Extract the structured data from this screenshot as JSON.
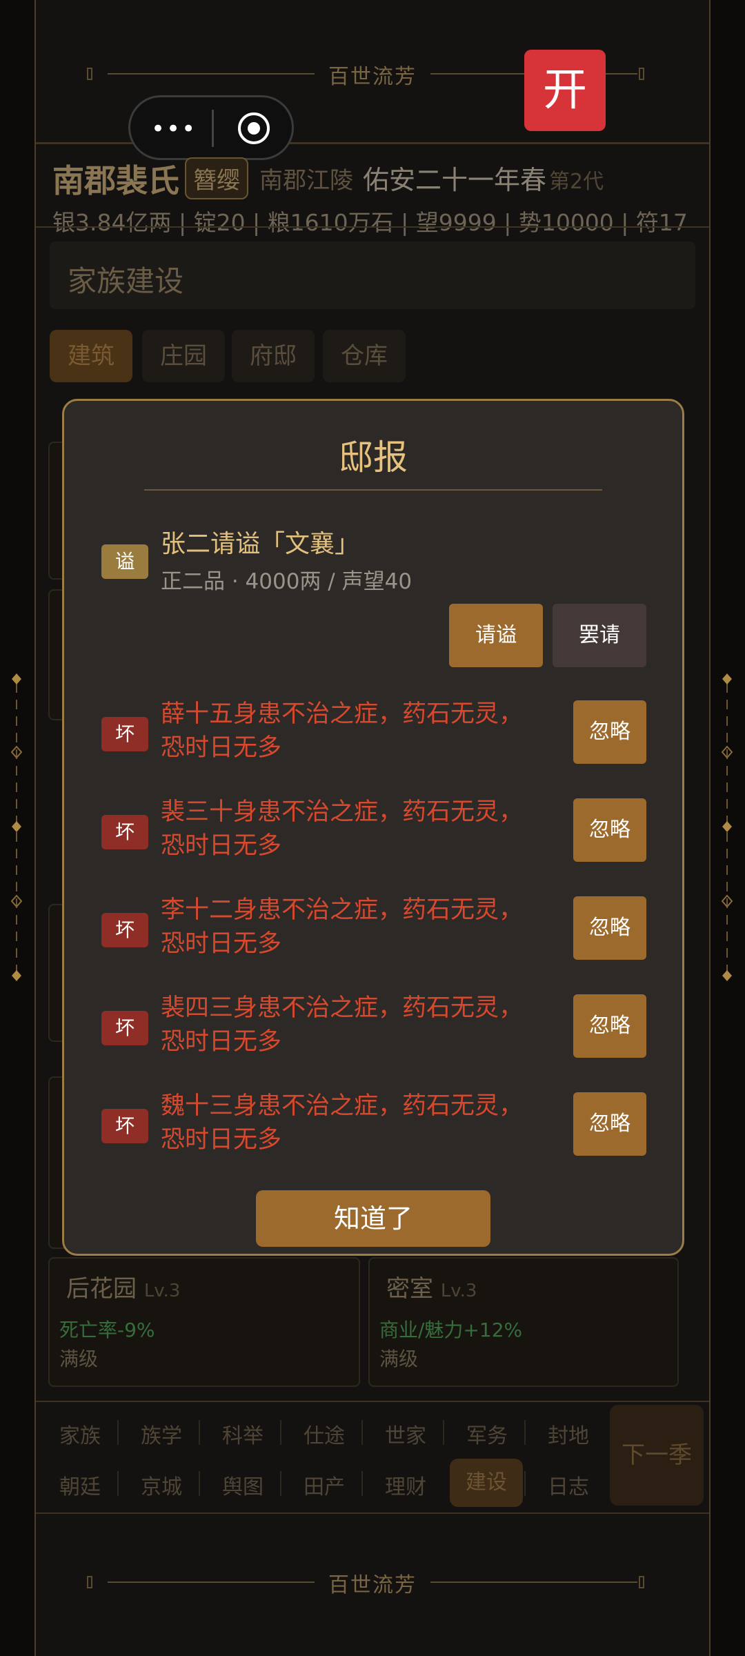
{
  "banner": {
    "text": "百世流芳"
  },
  "capsule": {
    "dots": "•••"
  },
  "open_button": {
    "label": "开"
  },
  "header": {
    "clan": "南郡裴氏",
    "badge": "簪缨",
    "location": "南郡江陵",
    "year": "佑安二十一年春",
    "generation": "第2代",
    "stats": "银3.84亿两 | 锭20 | 粮1610万石 | 望9999 | 势10000 | 符17"
  },
  "section": {
    "title": "家族建设"
  },
  "tabs": [
    "建筑",
    "庄园",
    "府邸",
    "仓库"
  ],
  "cards": [
    {
      "name": "后花园",
      "level": "Lv.3",
      "effect": "死亡率-9%",
      "status": "满级"
    },
    {
      "name": "密室",
      "level": "Lv.3",
      "effect": "商业/魅力+12%",
      "status": "满级"
    }
  ],
  "nav": {
    "row1": [
      "家族",
      "族学",
      "科举",
      "仕途",
      "世家",
      "军务",
      "封地"
    ],
    "row2": [
      "朝廷",
      "京城",
      "舆图",
      "田产",
      "理财",
      "建设",
      "日志"
    ],
    "next": "下一季"
  },
  "modal": {
    "title": "邸报",
    "shi": {
      "tag": "谥",
      "title": "张二请谥「文襄」",
      "sub": "正二品 · 4000两 / 声望40",
      "approve": "请谥",
      "reject": "罢请"
    },
    "events": [
      {
        "tag": "坏",
        "line1": "薛十五身患不治之症，药石无灵，",
        "line2": "恐时日无多",
        "action": "忽略"
      },
      {
        "tag": "坏",
        "line1": "裴三十身患不治之症，药石无灵，",
        "line2": "恐时日无多",
        "action": "忽略"
      },
      {
        "tag": "坏",
        "line1": "李十二身患不治之症，药石无灵，",
        "line2": "恐时日无多",
        "action": "忽略"
      },
      {
        "tag": "坏",
        "line1": "裴四三身患不治之症，药石无灵，",
        "line2": "恐时日无多",
        "action": "忽略"
      },
      {
        "tag": "坏",
        "line1": "魏十三身患不治之症，药石无灵，",
        "line2": "恐时日无多",
        "action": "忽略"
      }
    ],
    "ok": "知道了"
  }
}
